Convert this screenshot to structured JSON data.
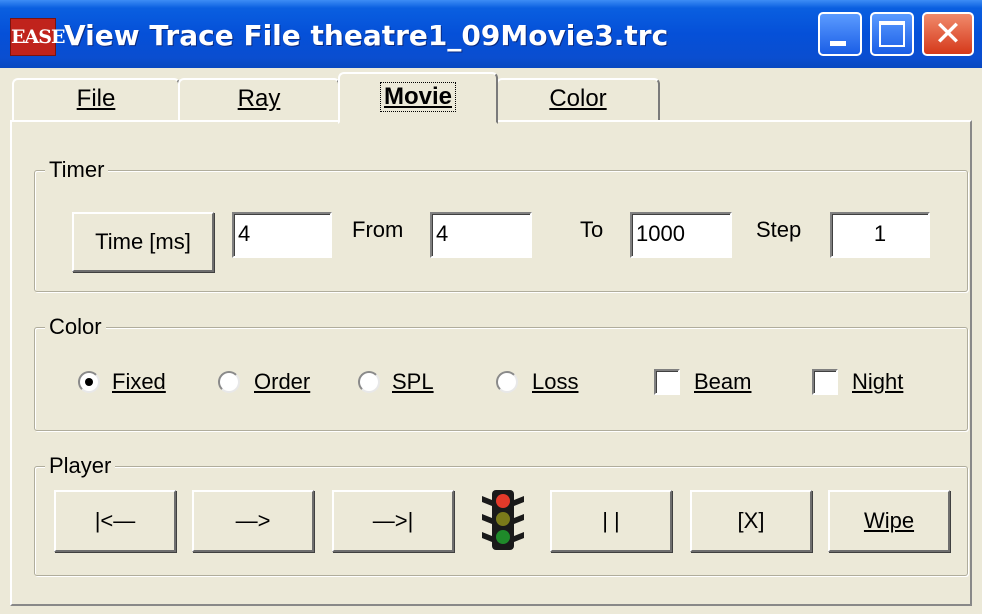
{
  "window": {
    "icon_text": "EASE",
    "title": "View Trace File theatre1_09Movie3.trc",
    "close_glyph": "✕"
  },
  "tabs": [
    {
      "label": "File",
      "selected": false
    },
    {
      "label": "Ray",
      "selected": false
    },
    {
      "label": "Movie",
      "selected": true
    },
    {
      "label": "Color",
      "selected": false
    }
  ],
  "timer": {
    "legend": "Timer",
    "time_button": "Time [ms]",
    "time_value": "4",
    "from_label": "From",
    "from_value": "4",
    "to_label": "To",
    "to_value": "1000",
    "step_label": "Step",
    "step_value": "1"
  },
  "color": {
    "legend": "Color",
    "radios": [
      {
        "label": "Fixed",
        "checked": true
      },
      {
        "label": "Order",
        "checked": false
      },
      {
        "label": "SPL",
        "checked": false
      },
      {
        "label": "Loss",
        "checked": false
      }
    ],
    "checks": [
      {
        "label": "Beam",
        "checked": false
      },
      {
        "label": "Night",
        "checked": false
      }
    ]
  },
  "player": {
    "legend": "Player",
    "buttons": {
      "rewind": "|<—",
      "play": "—>",
      "end": "—>|",
      "pause": "| |",
      "stop": "[X]",
      "wipe": "Wipe"
    },
    "traffic_light_icon": "traffic-light-icon"
  },
  "colors": {
    "titlebar": "#0550d8",
    "face": "#ece9d8",
    "icon_red": "#c0231c"
  }
}
